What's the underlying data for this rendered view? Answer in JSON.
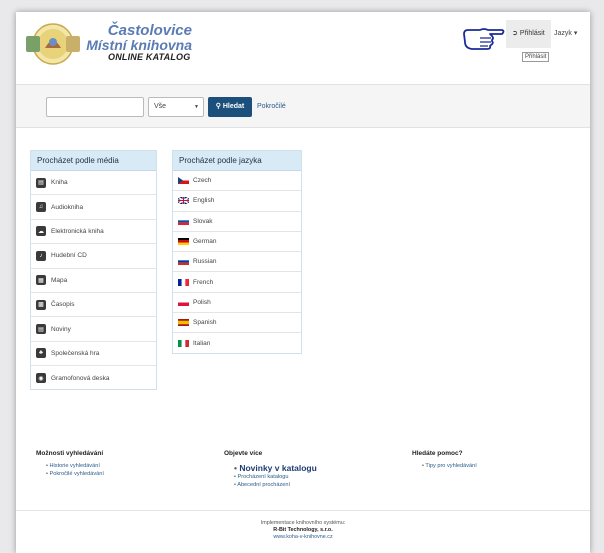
{
  "header": {
    "title_line1": "Častolovice",
    "title_line2": "Místní knihovna",
    "subtitle": "ONLINE KATALOG",
    "login_label": "Přihlásit",
    "login_tooltip": "Přihlásit",
    "language_label": "Jazyk"
  },
  "search": {
    "query_value": "",
    "scope_selected": "Vše",
    "search_button": "Hledat",
    "advanced_link": "Pokročilé"
  },
  "media_panel": {
    "title": "Procházet podle média",
    "items": [
      {
        "label": "Kniha",
        "icon": "book-icon"
      },
      {
        "label": "Audiokniha",
        "icon": "audio-icon"
      },
      {
        "label": "Elektronická kniha",
        "icon": "cloud-icon"
      },
      {
        "label": "Hudební CD",
        "icon": "music-icon"
      },
      {
        "label": "Mapa",
        "icon": "map-icon"
      },
      {
        "label": "Časopis",
        "icon": "magazine-icon"
      },
      {
        "label": "Noviny",
        "icon": "newspaper-icon"
      },
      {
        "label": "Společenská hra",
        "icon": "puzzle-icon"
      },
      {
        "label": "Gramofonová deska",
        "icon": "vinyl-icon"
      }
    ]
  },
  "language_panel": {
    "title": "Procházet podle jazyka",
    "items": [
      {
        "label": "Czech",
        "flag": "czech-flag-icon"
      },
      {
        "label": "English",
        "flag": "uk-flag-icon"
      },
      {
        "label": "Slovak",
        "flag": "slovak-flag-icon"
      },
      {
        "label": "German",
        "flag": "german-flag-icon"
      },
      {
        "label": "Russian",
        "flag": "russian-flag-icon"
      },
      {
        "label": "French",
        "flag": "french-flag-icon"
      },
      {
        "label": "Polish",
        "flag": "polish-flag-icon"
      },
      {
        "label": "Spanish",
        "flag": "spanish-flag-icon"
      },
      {
        "label": "Italian",
        "flag": "italian-flag-icon"
      }
    ]
  },
  "footer": {
    "col1": {
      "title": "Možnosti vyhledávání",
      "links": [
        "Historie vyhledávání",
        "Pokročilé vyhledávání"
      ]
    },
    "col2": {
      "title": "Objevte více",
      "featured": "Novinky v katalogu",
      "links": [
        "Procházení katalogu",
        "Abecední procházení"
      ]
    },
    "col3": {
      "title": "Hledáte pomoc?",
      "links": [
        "Tipy pro vyhledávání"
      ]
    },
    "implementation_line": "Implementace knihovního systému:",
    "company": "R-Bit Technology, s.r.o.",
    "company_url": "www.koha-v-knihovne.cz"
  },
  "colors": {
    "accent": "#1d4f7c",
    "title_blue": "#5a7bb3",
    "panel_header": "#d9eaf7",
    "link": "#2a5c8a"
  }
}
